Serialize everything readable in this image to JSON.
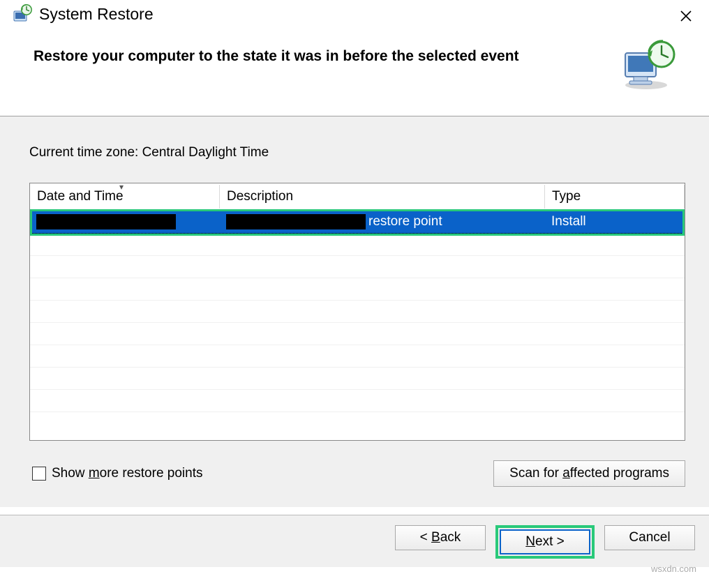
{
  "window": {
    "title": "System Restore"
  },
  "header": {
    "heading": "Restore your computer to the state it was in before the selected event"
  },
  "timezone_line": "Current time zone: Central Daylight Time",
  "table": {
    "columns": {
      "c1": "Date and Time",
      "c2": "Description",
      "c3": "Type"
    },
    "rows": [
      {
        "date": "",
        "description_suffix": "restore point",
        "type": "Install",
        "selected": true
      }
    ]
  },
  "show_more": {
    "label_prefix": "Show ",
    "label_u": "m",
    "label_suffix": "ore restore points",
    "checked": false
  },
  "scan_button": {
    "prefix": "Scan for ",
    "u": "a",
    "suffix": "ffected programs"
  },
  "buttons": {
    "back": {
      "prefix": "< ",
      "u": "B",
      "suffix": "ack"
    },
    "next": {
      "u": "N",
      "suffix": "ext >"
    },
    "cancel": "Cancel"
  },
  "watermark": "wsxdn.com"
}
